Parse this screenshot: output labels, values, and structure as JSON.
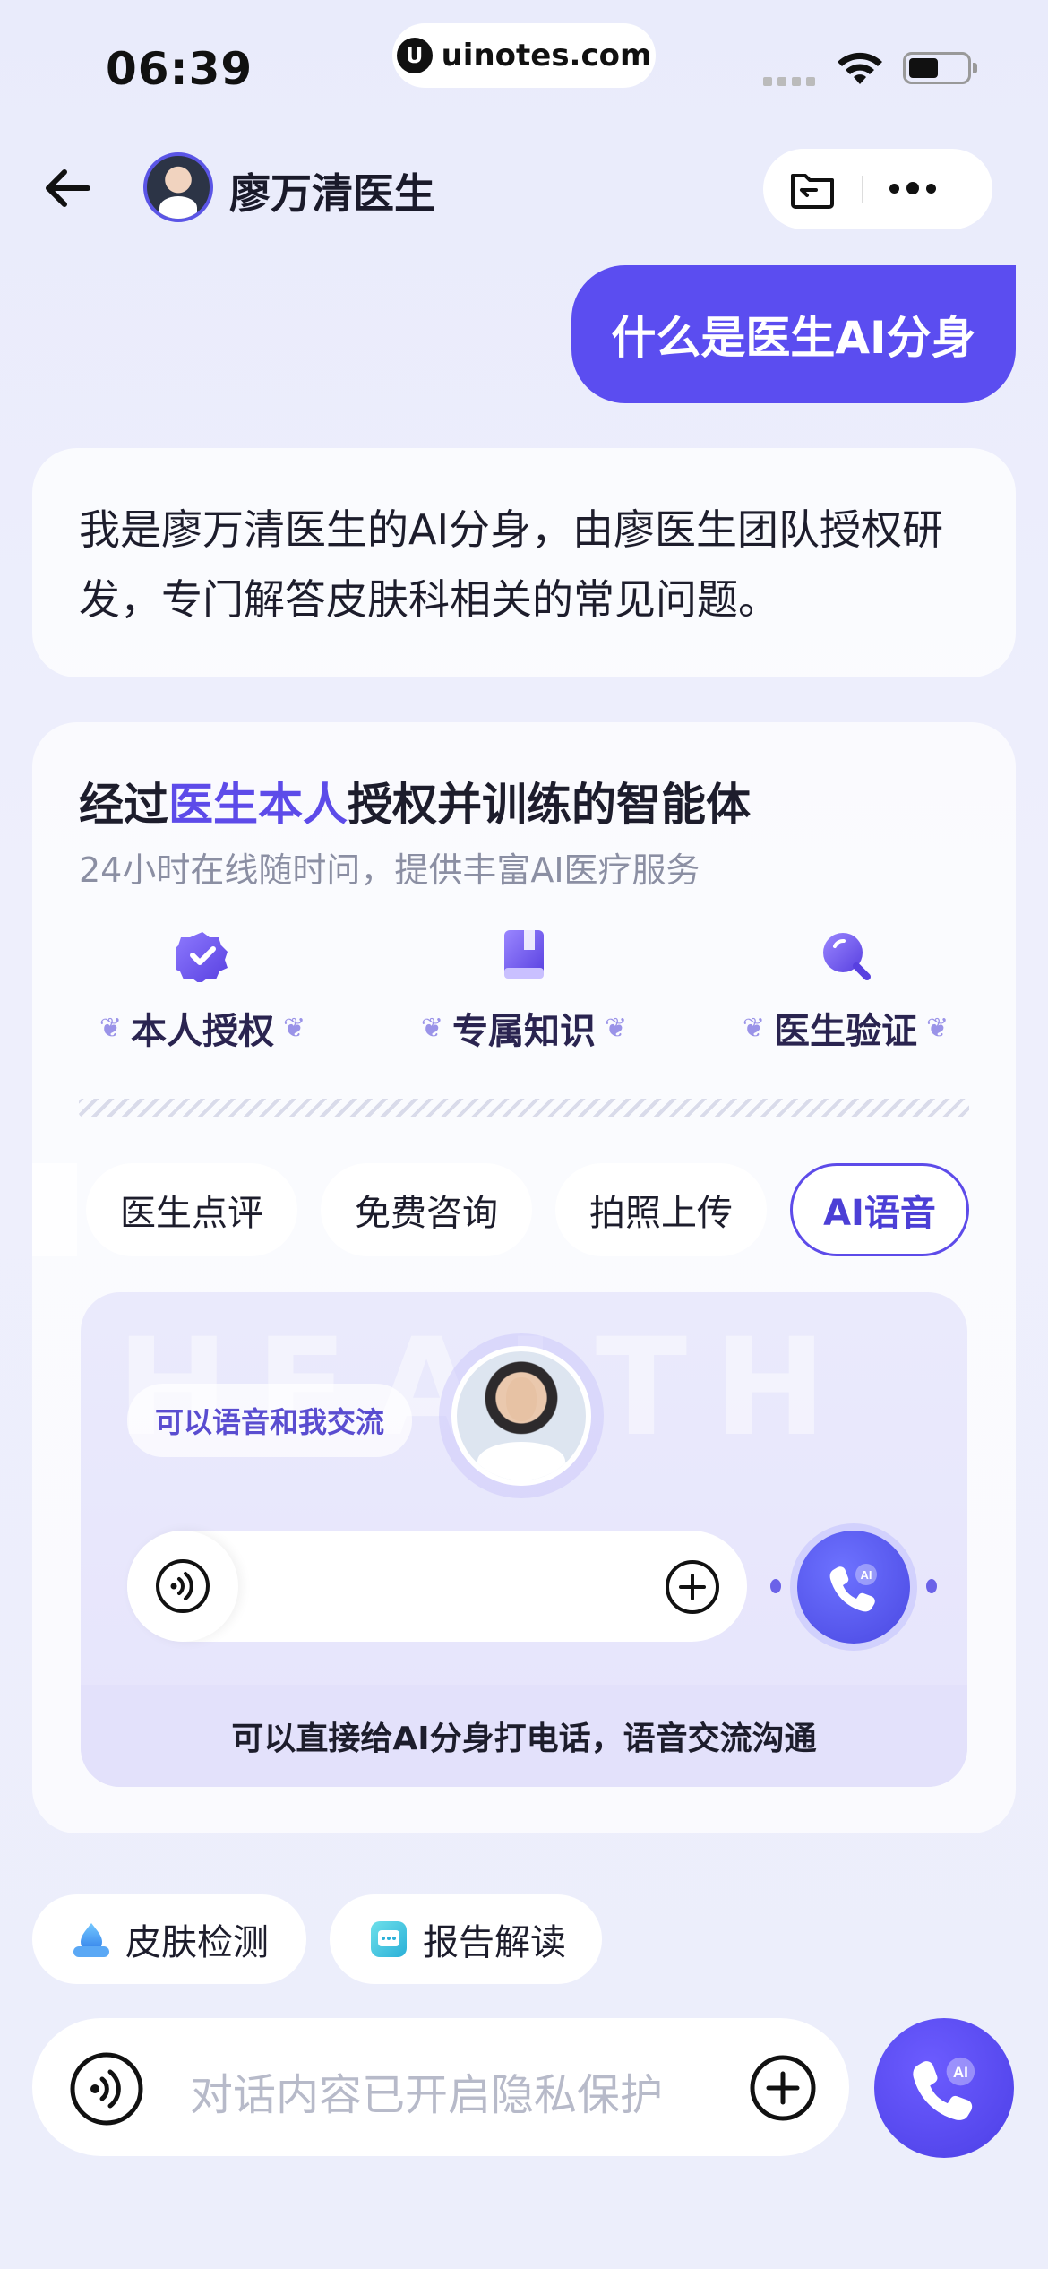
{
  "status_bar": {
    "time": "06:39",
    "url": "uinotes.com"
  },
  "header": {
    "doctor_name": "廖万清医生"
  },
  "user_message": "什么是医生AI分身",
  "bot_message": "我是廖万清医生的AI分身，由廖医生团队授权研发，专门解答皮肤科相关的常见问题。",
  "card": {
    "title_prefix": "经过",
    "title_highlight": "医生本人",
    "title_suffix": "授权并训练的智能体",
    "subtitle": "24小时在线随时问，提供丰富AI医疗服务",
    "features": [
      {
        "label": "本人授权",
        "icon": "check-badge-icon"
      },
      {
        "label": "专属知识",
        "icon": "book-icon"
      },
      {
        "label": "医生验证",
        "icon": "magnifier-icon"
      }
    ],
    "tabs": [
      {
        "label": "医生点评"
      },
      {
        "label": "免费咨询"
      },
      {
        "label": "拍照上传"
      },
      {
        "label": "AI语音",
        "active": true
      }
    ],
    "voice": {
      "hint": "可以语音和我交流",
      "footer": "可以直接给AI分身打电话，语音交流沟通"
    }
  },
  "quick_actions": [
    {
      "label": "皮肤检测",
      "icon": "skin-drop-icon"
    },
    {
      "label": "报告解读",
      "icon": "report-chat-icon"
    }
  ],
  "input": {
    "placeholder": "对话内容已开启隐私保护"
  },
  "colors": {
    "accent": "#5b4df0",
    "background": "#eceefb",
    "muted_text": "#8b8fa3"
  }
}
